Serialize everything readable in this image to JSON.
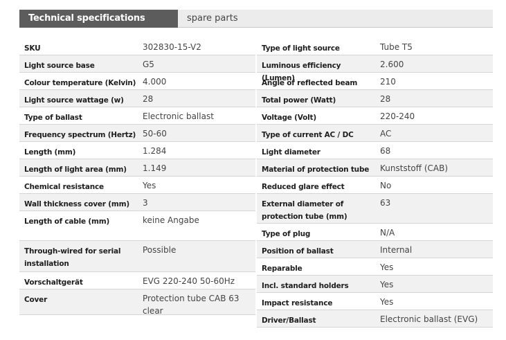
{
  "tabs": {
    "active": "Technical specifications",
    "inactive": "spare parts"
  },
  "left_rows": [
    {
      "label": "SKU",
      "value": "302830-15-V2"
    },
    {
      "label": "Light source base",
      "value": "G5"
    },
    {
      "label": "Colour temperature (Kelvin)",
      "value": "4.000"
    },
    {
      "label": "Light source wattage (w)",
      "value": "28"
    },
    {
      "label": "Type of ballast",
      "value": "Electronic ballast"
    },
    {
      "label": "Frequency spectrum (Hertz)",
      "value": "50-60"
    },
    {
      "label": "Length (mm)",
      "value": "1.284"
    },
    {
      "label": "Length of light area (mm)",
      "value": "1.149"
    },
    {
      "label": "Chemical resistance",
      "value": "Yes"
    },
    {
      "label": "Wall thickness cover (mm)",
      "value": "3"
    },
    {
      "label": "Length of cable (mm)",
      "value": "keine Angabe"
    },
    {
      "label": "Through-wired for serial installation",
      "value": "Possible"
    },
    {
      "label": "Vorschaltgerät",
      "value": "EVG 220-240 50-60Hz"
    },
    {
      "label": "Cover",
      "value": "Protection tube CAB 63 clear"
    }
  ],
  "right_rows": [
    {
      "label": "Type of light source",
      "value": "Tube T5"
    },
    {
      "label": "Luminous efficiency (Lumen)",
      "value": "2.600"
    },
    {
      "label": "Angle of reflected beam",
      "value": "210"
    },
    {
      "label": "Total power (Watt)",
      "value": "28"
    },
    {
      "label": "Voltage (Volt)",
      "value": "220-240"
    },
    {
      "label": "Type of current AC / DC",
      "value": "AC"
    },
    {
      "label": "Light diameter",
      "value": "68"
    },
    {
      "label": "Material of protection tube",
      "value": "Kunststoff (CAB)"
    },
    {
      "label": "Reduced glare effect",
      "value": "No"
    },
    {
      "label": "External diameter of protection tube (mm)",
      "value": "63"
    },
    {
      "label": "Type of plug",
      "value": "N/A"
    },
    {
      "label": "Position of ballast",
      "value": "Internal"
    },
    {
      "label": "Reparable",
      "value": "Yes"
    },
    {
      "label": "Incl. standard holders",
      "value": "Yes"
    },
    {
      "label": "Impact resistance",
      "value": "Yes"
    },
    {
      "label": "Driver/Ballast",
      "value": "Electronic ballast (EVG)"
    }
  ]
}
